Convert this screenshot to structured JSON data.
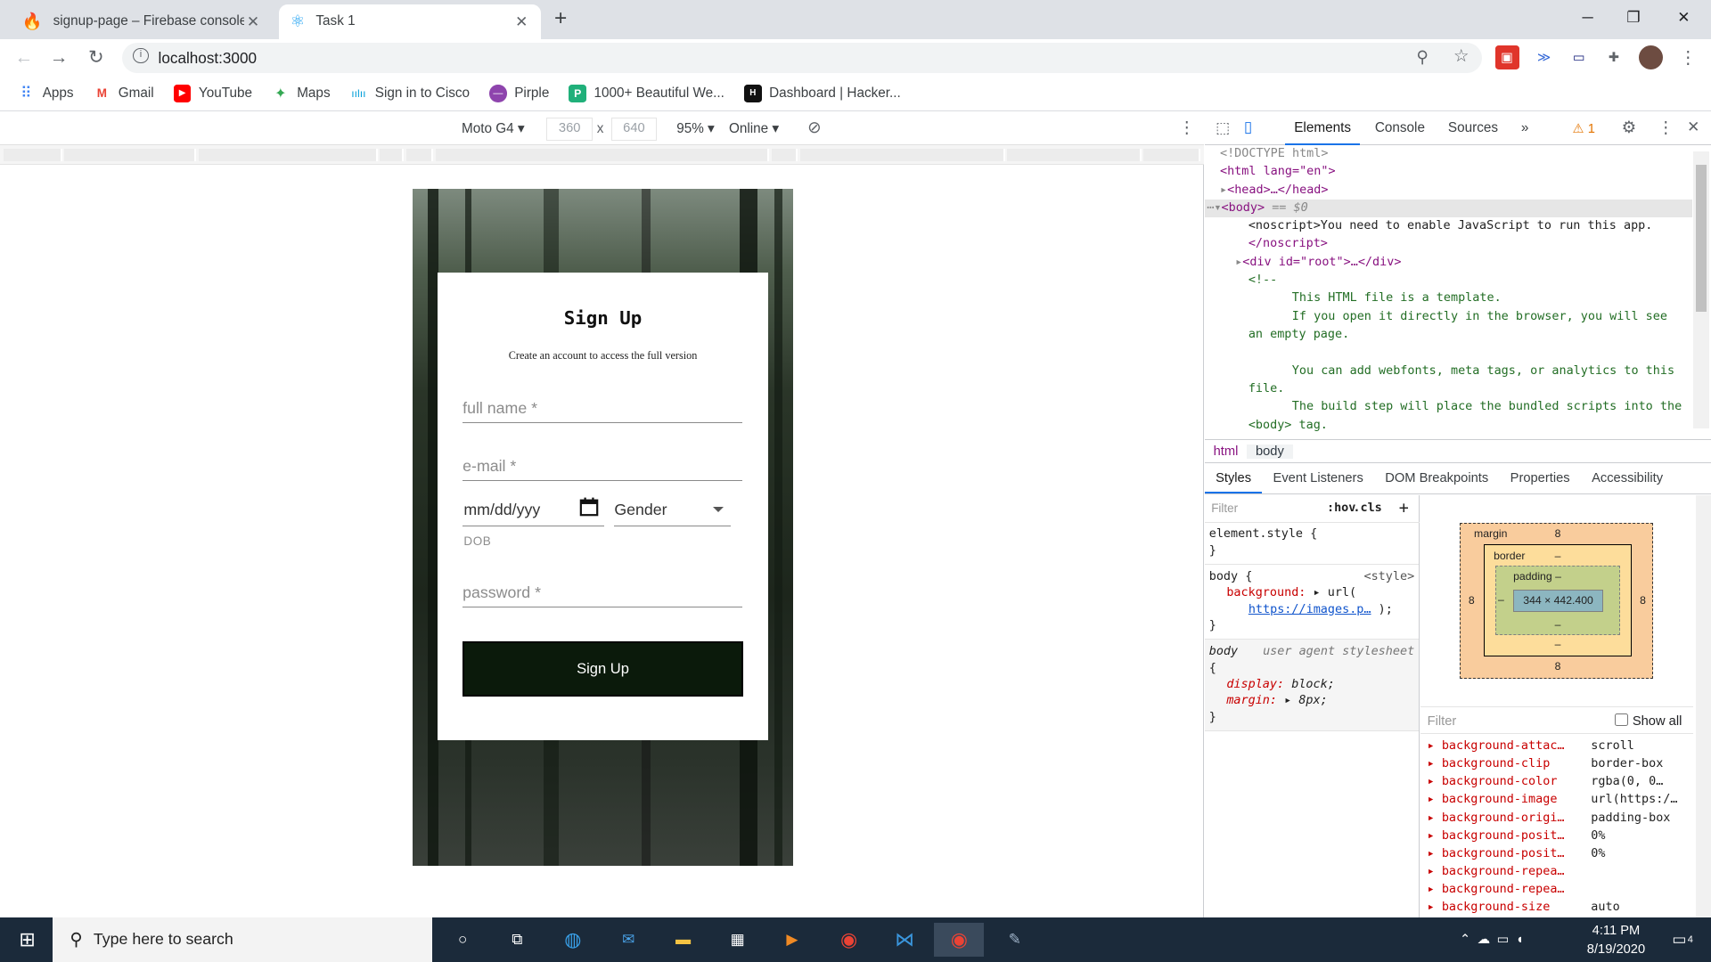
{
  "browser": {
    "tabs": [
      {
        "title": "signup-page – Firebase console",
        "icon": "firebase-icon",
        "close": "✕"
      },
      {
        "title": "Task 1",
        "icon": "react-icon",
        "close": "✕"
      }
    ],
    "new_tab": "+",
    "url": "localhost:3000",
    "window_controls": {
      "minimize": "─",
      "maximize": "❐",
      "close": "✕"
    }
  },
  "bookmarks": [
    {
      "label": "Apps",
      "icon": "apps-grid-icon",
      "color": "#4285f4"
    },
    {
      "label": "Gmail",
      "icon": "gmail-icon",
      "color": "#ea4335"
    },
    {
      "label": "YouTube",
      "icon": "youtube-icon",
      "color": "#ff0000"
    },
    {
      "label": "Maps",
      "icon": "maps-icon",
      "color": "#34a853"
    },
    {
      "label": "Sign in to Cisco",
      "icon": "cisco-icon",
      "color": "#049fd9"
    },
    {
      "label": "Pirple",
      "icon": "pirple-icon",
      "color": "#8e44ad"
    },
    {
      "label": "1000+ Beautiful We...",
      "icon": "p-icon",
      "color": "#20b07a"
    },
    {
      "label": "Dashboard | Hacker...",
      "icon": "hackerrank-icon",
      "color": "#111111"
    }
  ],
  "device_toolbar": {
    "device": "Moto G4",
    "width": "360",
    "height": "640",
    "times": "x",
    "zoom": "95%",
    "network": "Online"
  },
  "signup": {
    "title": "Sign Up",
    "subtitle": "Create an account to access the full version",
    "full_name_placeholder": "full name *",
    "email_placeholder": "e-mail *",
    "dob_placeholder": "mm/dd/yyy",
    "gender_label": "Gender",
    "dob_label": "DOB",
    "password_placeholder": "password *",
    "button_label": "Sign Up",
    "button_color": "#0b1a0b"
  },
  "devtools": {
    "tabs": [
      "Elements",
      "Console",
      "Sources",
      "»"
    ],
    "warning": "⚠ 1",
    "elements": {
      "doctype": "<!DOCTYPE html>",
      "html_open": "<html lang=\"en\">",
      "head": "<head>…</head>",
      "body_open": "<body>",
      "body_eq": " == $0",
      "noscript": "<noscript>You need to enable JavaScript to run this app.",
      "noscript_close": "</noscript>",
      "root_div": "<div id=\"root\">…</div>",
      "comment_open": "<!--",
      "comment_lines": [
        "This HTML file is a template.",
        "If you open it directly in the browser, you will see",
        "an empty page.",
        "",
        "You can add webfonts, meta tags, or analytics to this",
        "file.",
        "The build step will place the bundled scripts into the",
        "<body> tag."
      ]
    },
    "breadcrumbs": [
      "html",
      "body"
    ],
    "sub_tabs": [
      "Styles",
      "Event Listeners",
      "DOM Breakpoints",
      "Properties",
      "Accessibility"
    ],
    "styles": {
      "filter": "Filter",
      "hov": ":hov",
      "cls": ".cls",
      "plus": "+",
      "element_style": "element.style {",
      "close_brace": "}",
      "body_selector": "body {",
      "style_source": "<style>",
      "background_prop": "background:",
      "background_val": "url(",
      "background_link": "https://images.p…",
      "background_end": ");",
      "ua_selector": "body",
      "ua_source": "user agent stylesheet",
      "ua_open": "{",
      "display_prop": "display:",
      "display_val": "block;",
      "margin_prop": "margin:",
      "margin_val": "8px;"
    },
    "box_model": {
      "margin_label": "margin",
      "margin_value": "8",
      "margin_bottom": "8",
      "margin_left": "8",
      "margin_right": "8",
      "border_label": "border",
      "border_value": "–",
      "border_bottom": "–",
      "padding_label": "padding –",
      "padding_bottom": "–",
      "padding_side": "–",
      "content": "344 × 442.400"
    },
    "computed": {
      "filter": "Filter",
      "show_all": "Show all",
      "rows": [
        {
          "name": "background-attac…",
          "value": "scroll"
        },
        {
          "name": "background-clip",
          "value": "border-box"
        },
        {
          "name": "background-color",
          "value": "rgba(0, 0…"
        },
        {
          "name": "background-image",
          "value": "url(https:/…"
        },
        {
          "name": "background-origi…",
          "value": "padding-box"
        },
        {
          "name": "background-posit…",
          "value": "0%"
        },
        {
          "name": "background-posit…",
          "value": "0%"
        },
        {
          "name": "background-repea…",
          "value": ""
        },
        {
          "name": "background-repea…",
          "value": ""
        },
        {
          "name": "background-size",
          "value": "auto"
        }
      ]
    }
  },
  "taskbar": {
    "search_placeholder": "Type here to search",
    "time": "4:11 PM",
    "date": "8/19/2020",
    "notification_count": "4"
  }
}
